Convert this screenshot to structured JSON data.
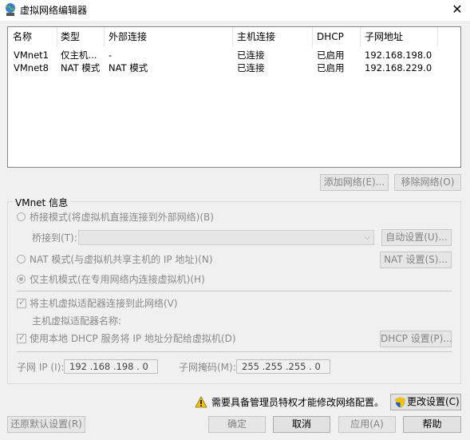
{
  "window": {
    "title": "虚拟网络编辑器",
    "close_glyph": "✕"
  },
  "network_list": {
    "columns": [
      "名称",
      "类型",
      "外部连接",
      "主机连接",
      "DHCP",
      "子网地址"
    ],
    "rows": [
      {
        "name": "VMnet1",
        "type": "仅主机...",
        "external": "-",
        "host": "已连接",
        "dhcp": "已启用",
        "subnet": "192.168.198.0"
      },
      {
        "name": "VMnet8",
        "type": "NAT 模式",
        "external": "NAT 模式",
        "host": "已连接",
        "dhcp": "已启用",
        "subnet": "192.168.229.0"
      }
    ]
  },
  "list_buttons": {
    "add": "添加网络(E)...",
    "remove": "移除网络(O)"
  },
  "vmnet_info": {
    "legend": "VMnet 信息",
    "bridge_mode": "桥接模式(将虚拟机直接连接到外部网络)(B)",
    "bridge_to_label": "桥接到(T):",
    "bridge_to_value": "",
    "auto_settings": "自动设置(U)...",
    "nat_mode": "NAT 模式(与虚拟机共享主机的 IP 地址)(N)",
    "nat_settings": "NAT 设置(S)...",
    "host_only_mode": "仅主机模式(在专用网络内连接虚拟机)(H)",
    "connect_adapter": "将主机虚拟适配器连接到此网络(V)",
    "adapter_name_label": "主机虚拟适配器名称:",
    "use_dhcp": "使用本地 DHCP 服务将 IP 地址分配给虚拟机(D)",
    "dhcp_settings": "DHCP 设置(P)...",
    "subnet_ip_label": "子网 IP (I):",
    "subnet_ip_value": "192 .168 .198 .  0",
    "subnet_mask_label": "子网掩码(M):",
    "subnet_mask_value": "255 .255 .255 .  0",
    "selected_mode": "host_only",
    "connect_adapter_checked": true,
    "use_dhcp_checked": true
  },
  "admin_notice": {
    "text": "需要具备管理员特权才能修改网络配置。",
    "change_settings": "更改设置(C)"
  },
  "footer": {
    "restore_defaults": "还原默认设置(R)",
    "ok": "确定",
    "cancel": "取消",
    "apply": "应用(A)",
    "help": "帮助"
  }
}
